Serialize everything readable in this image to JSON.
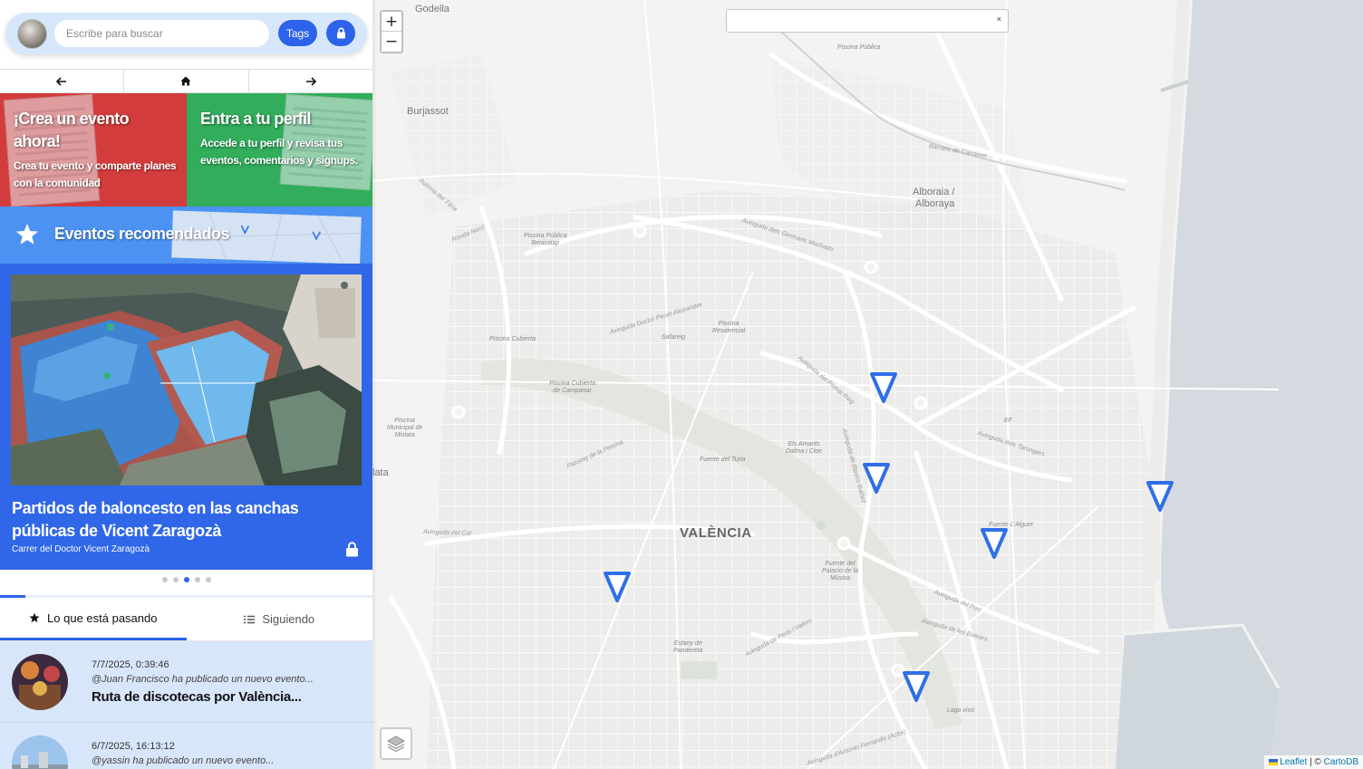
{
  "sidebar": {
    "search": {
      "placeholder": "Escribe para buscar",
      "value": ""
    },
    "tags_label": "Tags",
    "nav": {
      "back": "←",
      "home": "home",
      "forward": "→"
    },
    "cards": [
      {
        "title": "¡Crea un evento ahora!",
        "text": "Crea tu evento y comparte planes con la comunidad",
        "color": "#d33c3c"
      },
      {
        "title": "Entra a tu perfil",
        "text": "Accede a tu perfil y revisa tus eventos, comentarios y signups.",
        "color": "#31ad5b"
      }
    ],
    "recommended_title": "Eventos recomendados",
    "featured": {
      "title": "Partidos de baloncesto en las canchas públicas de Vicent Zaragozà",
      "address": "Carrer del Doctor Vicent Zaragozà",
      "private": true,
      "slide": 3,
      "slides_total": 5
    },
    "tabs": [
      {
        "label": "Lo que está pasando",
        "icon": "star-icon",
        "active": true
      },
      {
        "label": "Siguiendo",
        "icon": "list-icon",
        "active": false
      }
    ],
    "feed": [
      {
        "timestamp": "7/7/2025, 0:39:46",
        "byline": "@Juan Francisco ha publicado un nuevo evento...",
        "title": "Ruta de discotecas por València..."
      },
      {
        "timestamp": "6/7/2025, 16:13:12",
        "byline": "@yassin ha publicado un nuevo evento...",
        "title": ""
      }
    ]
  },
  "map": {
    "zoom_in": "+",
    "zoom_out": "−",
    "search_value": "",
    "search_clear": "×",
    "attribution": {
      "leaflet": "Leaflet",
      "separator": " | © ",
      "provider": "CartoDB"
    },
    "labels": {
      "godella": "Godella",
      "burjassot": "Burjassot",
      "alboraia": "Alboraia /",
      "alboraya": "Alboraya",
      "valencia": "VALÈNCIA",
      "lata": "lata",
      "piscina_publica": "Piscina Pública",
      "piscina_benicalap_1": "Piscina Pública",
      "piscina_benicalap_2": "Benicalap",
      "piscina_cubierta": "Piscina Cubierta",
      "safareig": "Safareig",
      "piscina_residencial_1": "Piscina",
      "piscina_residencial_2": "Residencial",
      "piscina_campanar_1": "Piscina Cubierta",
      "piscina_campanar_2": "de Campanar",
      "piscina_mislata_1": "Piscina",
      "piscina_mislata_2": "Municipal de",
      "piscina_mislata_3": "Mislata",
      "fuente_turia": "Fuente del Turia",
      "els_amants_1": "Els Amants",
      "els_amants_2": "Dalma i Cloe",
      "fuente_palau_1": "Fuente del",
      "fuente_palau_2": "Palacio de la",
      "fuente_palau_3": "Música",
      "fuente_alguer": "Fuente L'Alguer",
      "estany_1": "Estany de",
      "estany_2": "Pandereta",
      "lago_vivo": "Lago vivo",
      "ef": "EF",
      "av_germans": "Avinguda dels Germans Machado",
      "av_peset": "Avinguda Doctor Peset Aleixandre",
      "av_primat": "Avinguda del Primat Reig",
      "av_tarongers": "Avinguda dels Tarongers",
      "passeig_petxina": "Passeig de la Petxina",
      "av_cid": "Avinguda del Cid",
      "av_port": "Avinguda del Port",
      "av_balears": "Avinguda de les Balears",
      "av_perisvalero": "Avinguda de Peris i Valero",
      "av_turia": "Autovia del Túria",
      "ronda_nord": "Ronda Nord",
      "barranc": "Barranc de Carraixet",
      "av_ferrandis": "Avinguda d'Antonio Ferrandis (Actor)",
      "av_blasco": "Avinguda de Blasco Ibáñez"
    },
    "marker_color": "#2f6fe6",
    "markers": [
      {
        "name": "marker-primat-reig"
      },
      {
        "name": "marker-aragon"
      },
      {
        "name": "marker-malvarrosa"
      },
      {
        "name": "marker-port"
      },
      {
        "name": "marker-cid"
      },
      {
        "name": "marker-ciudad-ciencias"
      }
    ]
  }
}
